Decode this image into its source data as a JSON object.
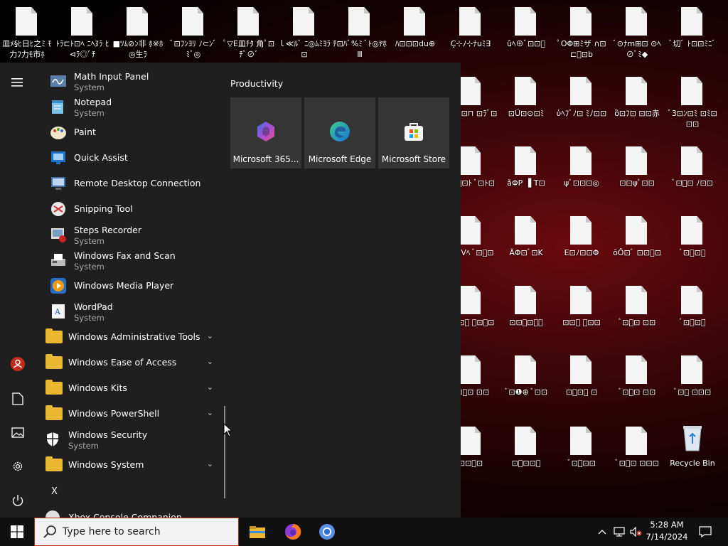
{
  "desktop": {
    "icons": [
      {
        "label": "皿ﾒ§ﾋ日ﾋ之ﾐ ﾓ力ﾌ力ﾓ市ﾎ"
      },
      {
        "label": "ﾄﾗ⊏ﾄ⊡ﾍ ﾆﾍﾇﾗ ﾋ⊲ﾗ◎ﾞﾁ"
      },
      {
        "label": "■ﾂﾑ⊘ﾝ非 ﾎ※ﾎ◎生ﾗ"
      },
      {
        "label": "ﾞ⊡ﾌﾝﾖﾘ ﾉ⊂ﾝﾞﾐﾞ◎"
      },
      {
        "label": "ﾟ▽E皿ﾁﾀ 角ﾟ⊡ﾁﾞ⊘ﾞ"
      },
      {
        "label": "ｌ≪ﾙﾞ ﾆ◎ﾑﾐﾖﾗ⊡"
      },
      {
        "label": "ﾁ⊡ﾊﾞ%ﾐ ﾞﾄ◎ﾔﾎⅢ"
      },
      {
        "label": "ﾊ⊡⊡⊡du⊕"
      },
      {
        "label": "Ç⊹ﾉ⊹ﾅuﾐ∃"
      },
      {
        "label": "ûﾍ⊕ﾞ⊡⊡ﾞ"
      },
      {
        "label": "ﾟOΦ⊞ﾐザ ∩⊡⊏ﾟ⊡b"
      },
      {
        "label": "ﾞ⊙ﾅm⊞⊡ ⊙ﾍ⊘ﾞﾐ◆"
      },
      {
        "label": "ﾞ切ﾞ ﾄ⊡⊡ﾐﾆﾞ"
      },
      {
        "label": "⊞ﾝ⊕⊡⊓ ⊡ﾗﾞ⊡"
      },
      {
        "label": "⊡Ü⊡⊙⊡ﾐ"
      },
      {
        "label": "ὑﾍﾌﾞﾉ⊡ ﾐﾉ⊡⊡"
      },
      {
        "label": "ὃ⊡ﾌ⊡ ⊡⊡赤"
      },
      {
        "label": "ﾞ3⊡ﾝ⊡ﾐ ⊡ﾐ⊡⊡⊡"
      },
      {
        "label": "ﾌ⊡ﾟ⊡ﾄ ﾞ⊡ﾄ⊡"
      },
      {
        "label": "ǎΦP ▐ T⊡"
      },
      {
        "label": "ψﾞ⊡⊡⊡◎"
      },
      {
        "label": "⊡⊡ψﾟ⊡⊡"
      },
      {
        "label": "ﾞ⊡ﾞ⊡ ﾉ⊡⊡"
      },
      {
        "label": "⊡ﾞlVﾍ ﾞ⊡ﾞ⊡"
      },
      {
        "label": "ÄΦ⊡ﾞ⊡K"
      },
      {
        "label": "E⊡ﾉ⊡⊡Φ"
      },
      {
        "label": "ŏÔ⊡ﾞ ⊡⊡ﾞ⊡"
      },
      {
        "label": "ﾞ⊡ﾞ⊡ﾞ"
      },
      {
        "label": "⊡ﾞ⊡ﾞ ﾞ⊡ﾞ⊡"
      },
      {
        "label": "⊡⊡ﾞ⊡ﾞﾞ"
      },
      {
        "label": "⊡⊡ﾞ ﾞ⊡⊡"
      },
      {
        "label": "ﾞ⊡ﾞ⊡ ⊡⊡"
      },
      {
        "label": "ﾞ⊡ﾞ⊡ﾞ"
      },
      {
        "label": "ﾞ⊡ﾞ⊡ ⊡⊡"
      },
      {
        "label": "ﾞ⊡❶⊕ ﾞ⊡⊡"
      },
      {
        "label": "⊡ﾞ⊡ﾞ ⊡"
      },
      {
        "label": "ﾞ⊡ﾞ⊡ ⊡⊡"
      },
      {
        "label": "ﾞ⊡ﾞ ⊡⊡⊡"
      },
      {
        "label": "⊡⊡ﾞ⊡"
      },
      {
        "label": "⊡ﾞ⊡⊡ﾞ"
      },
      {
        "label": "ﾞ⊡ﾞ⊡⊡"
      },
      {
        "label": "ﾞ⊡ﾞ⊡ ⊡⊡⊡"
      },
      {
        "label": "Recycle Bin"
      }
    ]
  },
  "start_menu": {
    "apps": [
      {
        "name": "Math Input Panel",
        "sub": "System"
      },
      {
        "name": "Notepad",
        "sub": "System"
      },
      {
        "name": "Paint",
        "sub": ""
      },
      {
        "name": "Quick Assist",
        "sub": ""
      },
      {
        "name": "Remote Desktop Connection",
        "sub": ""
      },
      {
        "name": "Snipping Tool",
        "sub": ""
      },
      {
        "name": "Steps Recorder",
        "sub": "System"
      },
      {
        "name": "Windows Fax and Scan",
        "sub": "System"
      },
      {
        "name": "Windows Media Player",
        "sub": ""
      },
      {
        "name": "WordPad",
        "sub": "System"
      }
    ],
    "folders": [
      {
        "name": "Windows Administrative Tools"
      },
      {
        "name": "Windows Ease of Access"
      },
      {
        "name": "Windows Kits"
      },
      {
        "name": "Windows PowerShell"
      }
    ],
    "security": {
      "name": "Windows Security",
      "sub": "System"
    },
    "system_folder": {
      "name": "Windows System"
    },
    "letter_x": "X",
    "xbox": {
      "name": "Xbox Console Companion"
    },
    "pinned_title": "Productivity",
    "tiles": [
      {
        "name": "Microsoft 365..."
      },
      {
        "name": "Microsoft Edge"
      },
      {
        "name": "Microsoft Store"
      }
    ]
  },
  "taskbar": {
    "search_placeholder": "Type here to search",
    "time": "5:28 AM",
    "date": "7/14/2024"
  },
  "colors": {
    "folder": "#e8b931",
    "accent": "#c42b1c"
  }
}
